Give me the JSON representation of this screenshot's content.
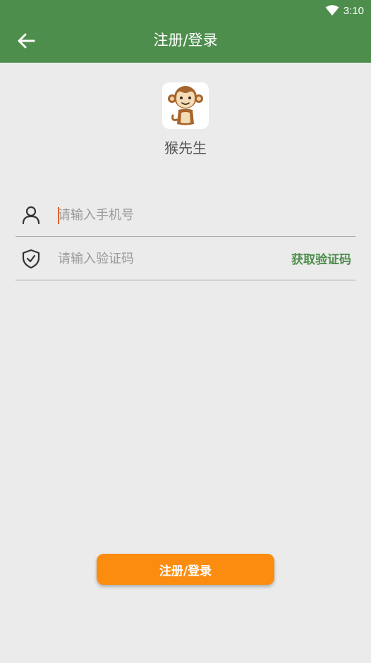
{
  "status_bar": {
    "time": "3:10",
    "wifi_icon": "wifi-icon"
  },
  "header": {
    "title": "注册/登录",
    "back_icon": "arrow-left-icon"
  },
  "app": {
    "name": "猴先生",
    "logo_icon": "monkey-logo-icon"
  },
  "form": {
    "phone": {
      "value": "",
      "placeholder": "请输入手机号",
      "icon": "user-icon"
    },
    "code": {
      "value": "",
      "placeholder": "请输入验证码",
      "icon": "shield-check-icon",
      "get_code_label": "获取验证码"
    },
    "submit_label": "注册/登录"
  },
  "colors": {
    "header_bg": "#4e8e4d",
    "page_bg": "#ebebeb",
    "accent_green": "#4e8e4d",
    "button_orange": "#fb8c0f",
    "caret": "#e0632a"
  }
}
